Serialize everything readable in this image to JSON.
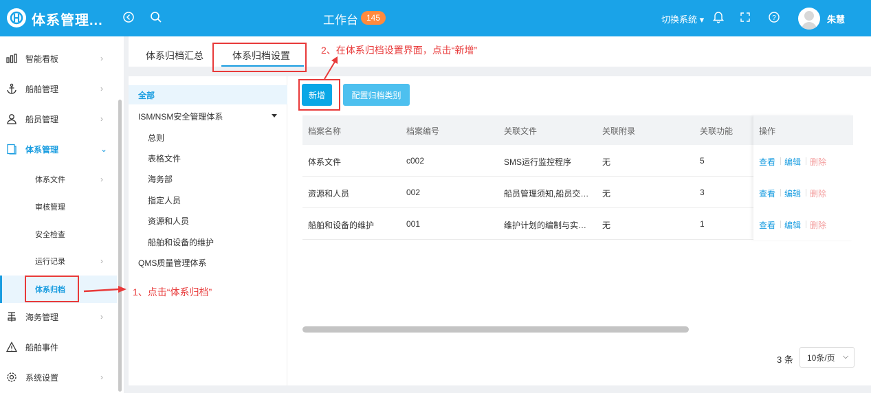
{
  "header": {
    "app_title": "体系管理...",
    "workbench_label": "工作台",
    "workbench_badge": "145",
    "switch_system": "切换系统 ▾",
    "username": "朱慧"
  },
  "sidebar": {
    "items": [
      {
        "label": "智能看板",
        "icon": "dashboard-icon"
      },
      {
        "label": "船舶管理",
        "icon": "anchor-icon"
      },
      {
        "label": "船员管理",
        "icon": "user-icon"
      },
      {
        "label": "体系管理",
        "icon": "document-icon"
      },
      {
        "label": "体系文件"
      },
      {
        "label": "审核管理"
      },
      {
        "label": "安全检查"
      },
      {
        "label": "运行记录"
      },
      {
        "label": "体系归档"
      },
      {
        "label": "海务管理",
        "icon": "sea-icon"
      },
      {
        "label": "船舶事件",
        "icon": "warning-icon"
      },
      {
        "label": "系统设置",
        "icon": "gear-icon"
      }
    ]
  },
  "tabs": [
    {
      "label": "体系归档汇总"
    },
    {
      "label": "体系归档设置"
    }
  ],
  "tree": {
    "nodes": [
      {
        "label": "全部"
      },
      {
        "label": "ISM/NSM安全管理体系"
      },
      {
        "label": "总则"
      },
      {
        "label": "表格文件"
      },
      {
        "label": "海务部"
      },
      {
        "label": "指定人员"
      },
      {
        "label": "资源和人员"
      },
      {
        "label": "船舶和设备的维护"
      },
      {
        "label": "QMS质量管理体系"
      }
    ]
  },
  "toolbar": {
    "add_label": "新增",
    "config_label": "配置归档类别"
  },
  "table": {
    "columns": [
      "档案名称",
      "档案编号",
      "关联文件",
      "关联附录",
      "关联功能",
      "操作"
    ],
    "rows": [
      {
        "name": "体系文件",
        "code": "c002",
        "file": "SMS运行监控程序",
        "appendix": "无",
        "func": "5"
      },
      {
        "name": "资源和人员",
        "code": "002",
        "file": "船员管理须知,船员交…",
        "appendix": "无",
        "func": "3"
      },
      {
        "name": "船舶和设备的维护",
        "code": "001",
        "file": "维护计划的编制与实…",
        "appendix": "无",
        "func": "1"
      }
    ],
    "actions": {
      "view": "查看",
      "edit": "编辑",
      "delete": "删除"
    }
  },
  "pager": {
    "total": "3 条",
    "page_size": "10条/页"
  },
  "annotations": {
    "step1": "1、点击“体系归档”",
    "step2": "2、在体系归档设置界面，点击“新增”",
    "color": "#e83a3a"
  }
}
